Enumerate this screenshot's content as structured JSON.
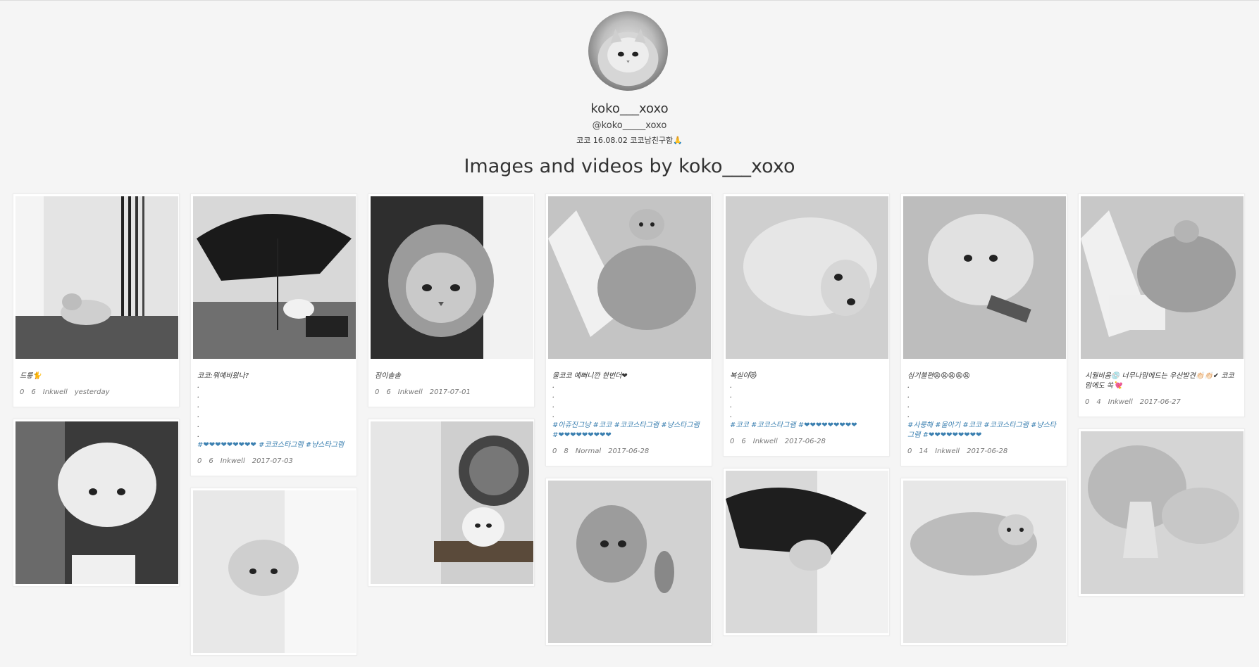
{
  "profile": {
    "name": "koko___xoxo",
    "handle": "@koko_____xoxo",
    "bio": "코코 16.08.02 코코남친구함🙏"
  },
  "heading": "Images and videos by koko___xoxo",
  "columns": [
    {
      "cards": [
        {
          "caption": "드릏🐈",
          "tags": "",
          "likes": "0",
          "comments": "6",
          "filter": "Inkwell",
          "date": "yesterday",
          "has_meta": true
        },
        {
          "caption": "",
          "tags": "",
          "likes": "",
          "comments": "",
          "filter": "",
          "date": "",
          "has_meta": false
        }
      ]
    },
    {
      "cards": [
        {
          "caption": "코코:뭐예비왔나?\n.\n.\n.\n.\n.\n.",
          "tags": "#❤❤❤❤❤❤❤❤❤ #코코스타그램 #냥스타그램",
          "likes": "0",
          "comments": "6",
          "filter": "Inkwell",
          "date": "2017-07-03",
          "has_meta": true
        },
        {
          "caption": "",
          "tags": "",
          "likes": "",
          "comments": "",
          "filter": "",
          "date": "",
          "has_meta": false
        }
      ]
    },
    {
      "cards": [
        {
          "caption": "잠이솔솔",
          "tags": "",
          "likes": "0",
          "comments": "6",
          "filter": "Inkwell",
          "date": "2017-07-01",
          "has_meta": true
        },
        {
          "caption": "",
          "tags": "",
          "likes": "",
          "comments": "",
          "filter": "",
          "date": "",
          "has_meta": false
        }
      ]
    },
    {
      "cards": [
        {
          "caption": "울코코 예뻐니깐 한번더❤\n.\n.\n.\n.",
          "tags": "#아쥬진그냥 #코코 #코코스타그램 #냥스타그램 #❤❤❤❤❤❤❤❤❤",
          "likes": "0",
          "comments": "8",
          "filter": "Normal",
          "date": "2017-06-28",
          "has_meta": true
        },
        {
          "caption": "",
          "tags": "",
          "likes": "",
          "comments": "",
          "filter": "",
          "date": "",
          "has_meta": false
        }
      ]
    },
    {
      "cards": [
        {
          "caption": "복실이😻\n.\n.\n.\n.",
          "tags": "#코코 #코코스타그램 #❤❤❤❤❤❤❤❤❤",
          "likes": "0",
          "comments": "6",
          "filter": "Inkwell",
          "date": "2017-06-28",
          "has_meta": true
        },
        {
          "caption": "",
          "tags": "",
          "likes": "",
          "comments": "",
          "filter": "",
          "date": "",
          "has_meta": false
        }
      ]
    },
    {
      "cards": [
        {
          "caption": "심기불편😩😩😩😩😩\n.\n.\n.\n.",
          "tags": "#사룽해 #울아기 #코코 #코코스타그램 #냥스타그램 #❤❤❤❤❤❤❤❤❤",
          "likes": "0",
          "comments": "14",
          "filter": "Inkwell",
          "date": "2017-06-28",
          "has_meta": true
        },
        {
          "caption": "",
          "tags": "",
          "likes": "",
          "comments": "",
          "filter": "",
          "date": "",
          "has_meta": false
        }
      ]
    },
    {
      "cards": [
        {
          "caption": "시월비움💿 너무나맘에드는 우산발견👏🏻👏🏻✔ 코코맘에도 쏙💘",
          "tags": "",
          "likes": "0",
          "comments": "4",
          "filter": "Inkwell",
          "date": "2017-06-27",
          "has_meta": true
        },
        {
          "caption": "",
          "tags": "",
          "likes": "",
          "comments": "",
          "filter": "",
          "date": "",
          "has_meta": false
        }
      ]
    }
  ]
}
